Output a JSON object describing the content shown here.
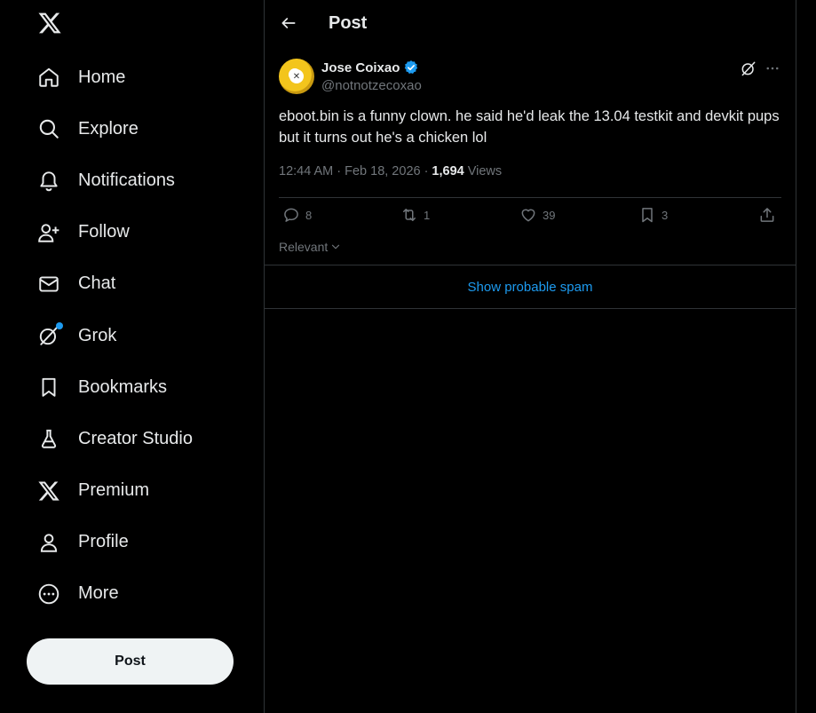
{
  "header": {
    "title": "Post"
  },
  "sidebar": {
    "items": [
      {
        "label": "Home",
        "icon": "home-icon"
      },
      {
        "label": "Explore",
        "icon": "search-icon"
      },
      {
        "label": "Notifications",
        "icon": "bell-icon"
      },
      {
        "label": "Follow",
        "icon": "person-plus-icon"
      },
      {
        "label": "Chat",
        "icon": "mail-icon"
      },
      {
        "label": "Grok",
        "icon": "grok-icon"
      },
      {
        "label": "Bookmarks",
        "icon": "bookmark-icon"
      },
      {
        "label": "Creator Studio",
        "icon": "flask-icon"
      },
      {
        "label": "Premium",
        "icon": "x-logo-icon"
      },
      {
        "label": "Profile",
        "icon": "person-icon"
      },
      {
        "label": "More",
        "icon": "more-circle-icon"
      }
    ],
    "post_label": "Post"
  },
  "tweet": {
    "author_name": "Jose Coixao",
    "author_handle": "@notnotzecoxao",
    "text": "eboot.bin is a funny clown. he said he'd leak the 13.04 testkit and devkit pups but it turns out he's a chicken lol",
    "time": "12:44 AM",
    "date": "Feb 18, 2026",
    "views_count": "1,694",
    "views_label": "Views",
    "replies": "8",
    "reposts": "1",
    "likes": "39",
    "bookmarks": "3"
  },
  "replies_sort": "Relevant",
  "spam_link": "Show probable spam",
  "colors": {
    "background": "#000000",
    "text": "#e7e9ea",
    "muted": "#71767b",
    "accent": "#1d9bf0",
    "border": "#2f3336",
    "post_button_bg": "#eff3f4"
  }
}
